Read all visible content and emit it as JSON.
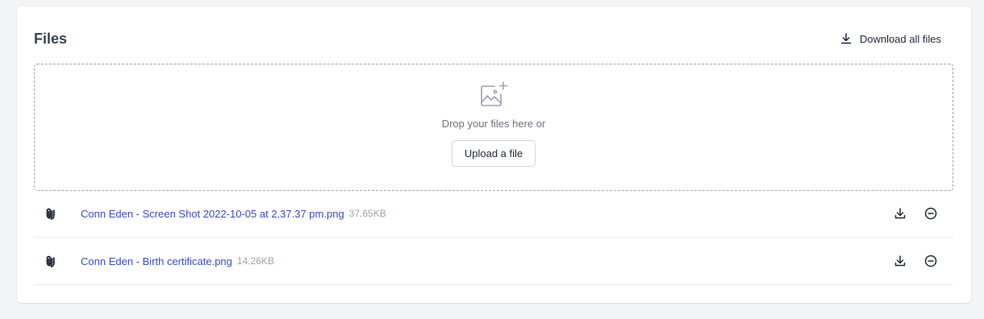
{
  "section": {
    "title": "Files",
    "download_all_label": "Download all files"
  },
  "dropzone": {
    "prompt": "Drop your files here or",
    "upload_label": "Upload a file",
    "icon": "image-add-icon"
  },
  "files": [
    {
      "name": "Conn Eden - Screen Shot 2022-10-05 at 2.37.37 pm.png",
      "size": "37.65KB"
    },
    {
      "name": "Conn Eden - Birth certificate.png",
      "size": "14.26KB"
    }
  ],
  "colors": {
    "link": "#3b4cc0",
    "muted": "#9ca3af",
    "background": "#f3f4f6"
  }
}
